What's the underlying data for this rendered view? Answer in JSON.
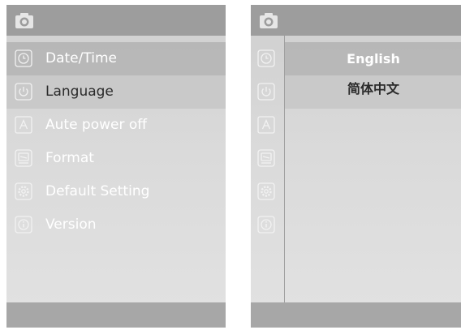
{
  "menu": {
    "items": [
      {
        "label": "Date/Time",
        "icon": "clock-icon"
      },
      {
        "label": "Language",
        "icon": "power-icon"
      },
      {
        "label": "Aute power off",
        "icon": "letter-a-icon"
      },
      {
        "label": "Format",
        "icon": "format-icon"
      },
      {
        "label": "Default Setting",
        "icon": "gear-icon"
      },
      {
        "label": "Version",
        "icon": "info-icon"
      }
    ],
    "selected": "Language"
  },
  "language_panel": {
    "options": [
      "English",
      "简体中文"
    ],
    "selected": "简体中文"
  },
  "colors": {
    "topbar": "#9d9d9d",
    "bottombar": "#a7a7a7",
    "row_highlight": "#c9c9c9",
    "text_light": "#ffffff",
    "text_dark": "#2a2a2a"
  }
}
